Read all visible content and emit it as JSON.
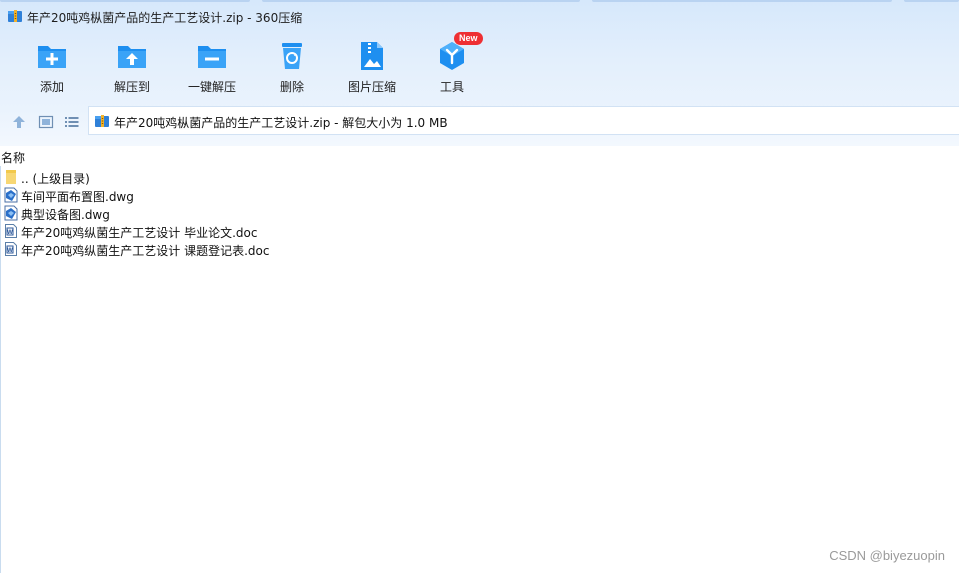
{
  "window": {
    "title": "年产20吨鸡枞菌产品的生产工艺设计.zip - 360压缩"
  },
  "toolbar": {
    "items": [
      {
        "label": "添加",
        "icon": "add-icon"
      },
      {
        "label": "解压到",
        "icon": "extract-to-icon"
      },
      {
        "label": "一键解压",
        "icon": "one-click-extract-icon"
      },
      {
        "label": "删除",
        "icon": "delete-icon"
      },
      {
        "label": "图片压缩",
        "icon": "image-compress-icon"
      },
      {
        "label": "工具",
        "icon": "tools-icon",
        "badge": "New"
      }
    ]
  },
  "address": {
    "path": "年产20吨鸡枞菌产品的生产工艺设计.zip - 解包大小为 1.0 MB"
  },
  "list": {
    "column_name": "名称",
    "files": [
      {
        "name": ".. (上级目录)",
        "icon": "folder-icon"
      },
      {
        "name": "车间平面布置图.dwg",
        "icon": "dwg-file-icon"
      },
      {
        "name": "典型设备图.dwg",
        "icon": "dwg-file-icon"
      },
      {
        "name": "年产20吨鸡纵菌生产工艺设计 毕业论文.doc",
        "icon": "doc-file-icon"
      },
      {
        "name": "年产20吨鸡纵菌生产工艺设计 课题登记表.doc",
        "icon": "doc-file-icon"
      }
    ]
  },
  "watermark": "CSDN @biyezuopin",
  "colors": {
    "accent": "#1e8ff0",
    "header_bg": "#dfecfb",
    "badge": "#ee2f33"
  }
}
